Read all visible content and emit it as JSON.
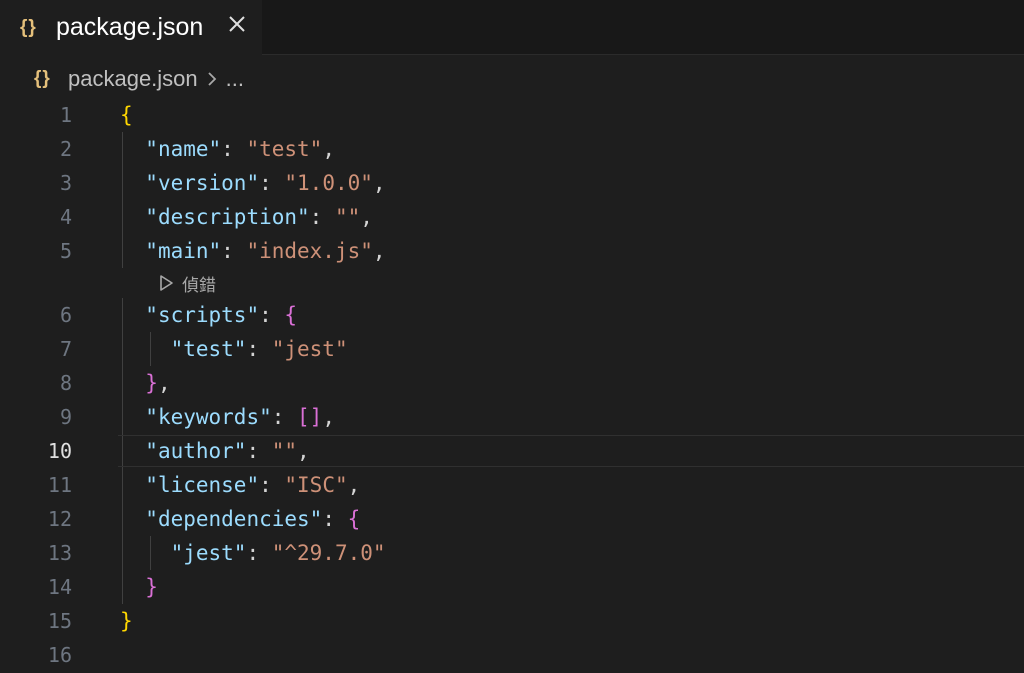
{
  "tab": {
    "icon": "{}",
    "title": "package.json",
    "close_icon": "close-icon"
  },
  "breadcrumb": {
    "icon": "{}",
    "file": "package.json",
    "separator_icon": "chevron-right-icon",
    "more": "..."
  },
  "codelens": {
    "icon": "play-icon",
    "label": "偵錯"
  },
  "editor": {
    "current_line": 10,
    "lines": [
      {
        "num": "1",
        "parts": [
          {
            "t": "{",
            "c": "b1"
          }
        ]
      },
      {
        "num": "2",
        "parts": [
          {
            "t": "  "
          },
          {
            "t": "\"name\"",
            "c": "k"
          },
          {
            "t": ": ",
            "c": "p"
          },
          {
            "t": "\"test\"",
            "c": "s"
          },
          {
            "t": ",",
            "c": "p"
          }
        ]
      },
      {
        "num": "3",
        "parts": [
          {
            "t": "  "
          },
          {
            "t": "\"version\"",
            "c": "k"
          },
          {
            "t": ": ",
            "c": "p"
          },
          {
            "t": "\"1.0.0\"",
            "c": "s"
          },
          {
            "t": ",",
            "c": "p"
          }
        ]
      },
      {
        "num": "4",
        "parts": [
          {
            "t": "  "
          },
          {
            "t": "\"description\"",
            "c": "k"
          },
          {
            "t": ": ",
            "c": "p"
          },
          {
            "t": "\"\"",
            "c": "s"
          },
          {
            "t": ",",
            "c": "p"
          }
        ]
      },
      {
        "num": "5",
        "parts": [
          {
            "t": "  "
          },
          {
            "t": "\"main\"",
            "c": "k"
          },
          {
            "t": ": ",
            "c": "p"
          },
          {
            "t": "\"index.js\"",
            "c": "s"
          },
          {
            "t": ",",
            "c": "p"
          }
        ]
      },
      {
        "num": "6",
        "parts": [
          {
            "t": "  "
          },
          {
            "t": "\"scripts\"",
            "c": "k"
          },
          {
            "t": ": ",
            "c": "p"
          },
          {
            "t": "{",
            "c": "b2"
          }
        ]
      },
      {
        "num": "7",
        "parts": [
          {
            "t": "    "
          },
          {
            "t": "\"test\"",
            "c": "k"
          },
          {
            "t": ": ",
            "c": "p"
          },
          {
            "t": "\"jest\"",
            "c": "s"
          }
        ]
      },
      {
        "num": "8",
        "parts": [
          {
            "t": "  "
          },
          {
            "t": "}",
            "c": "b2"
          },
          {
            "t": ",",
            "c": "p"
          }
        ]
      },
      {
        "num": "9",
        "parts": [
          {
            "t": "  "
          },
          {
            "t": "\"keywords\"",
            "c": "k"
          },
          {
            "t": ": ",
            "c": "p"
          },
          {
            "t": "[]",
            "c": "b2"
          },
          {
            "t": ",",
            "c": "p"
          }
        ]
      },
      {
        "num": "10",
        "parts": [
          {
            "t": "  "
          },
          {
            "t": "\"author\"",
            "c": "k"
          },
          {
            "t": ": ",
            "c": "p"
          },
          {
            "t": "\"\"",
            "c": "s"
          },
          {
            "t": ",",
            "c": "p"
          }
        ]
      },
      {
        "num": "11",
        "parts": [
          {
            "t": "  "
          },
          {
            "t": "\"license\"",
            "c": "k"
          },
          {
            "t": ": ",
            "c": "p"
          },
          {
            "t": "\"ISC\"",
            "c": "s"
          },
          {
            "t": ",",
            "c": "p"
          }
        ]
      },
      {
        "num": "12",
        "parts": [
          {
            "t": "  "
          },
          {
            "t": "\"dependencies\"",
            "c": "k"
          },
          {
            "t": ": ",
            "c": "p"
          },
          {
            "t": "{",
            "c": "b2"
          }
        ]
      },
      {
        "num": "13",
        "parts": [
          {
            "t": "    "
          },
          {
            "t": "\"jest\"",
            "c": "k"
          },
          {
            "t": ": ",
            "c": "p"
          },
          {
            "t": "\"^29.7.0\"",
            "c": "s"
          }
        ]
      },
      {
        "num": "14",
        "parts": [
          {
            "t": "  "
          },
          {
            "t": "}",
            "c": "b2"
          }
        ]
      },
      {
        "num": "15",
        "parts": [
          {
            "t": "}",
            "c": "b1"
          }
        ]
      },
      {
        "num": "16",
        "parts": []
      }
    ]
  },
  "colors": {
    "background": "#1e1e1e",
    "tabbar": "#181818",
    "json_key": "#9cdcfe",
    "json_string": "#ce9178",
    "bracket_level1": "#ffd700",
    "bracket_level2": "#da70d6",
    "file_icon": "#e5c07b"
  }
}
